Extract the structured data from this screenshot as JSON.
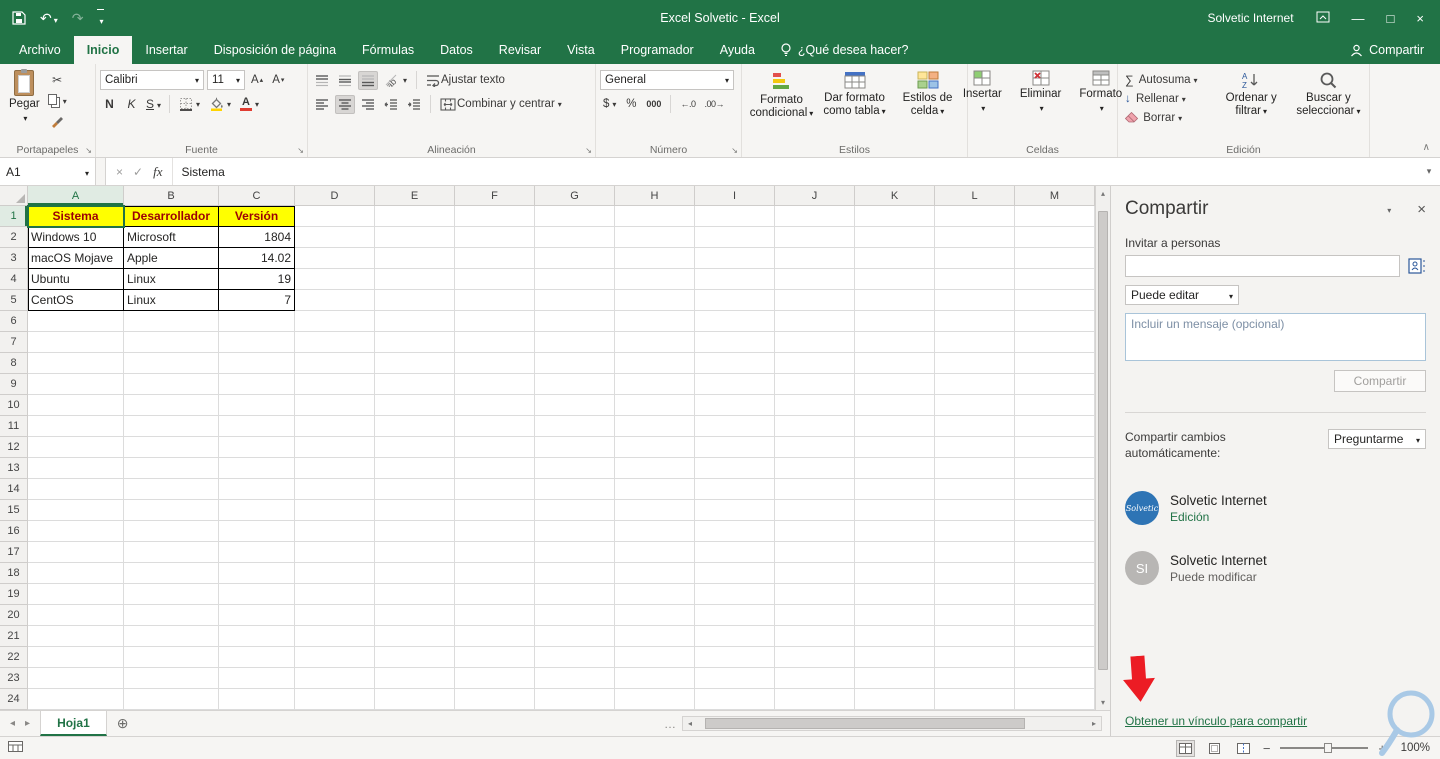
{
  "titlebar": {
    "title": "Excel Solvetic  -  Excel",
    "account": "Solvetic Internet"
  },
  "ribbon": {
    "tabs": [
      {
        "id": "archivo",
        "label": "Archivo",
        "active": false
      },
      {
        "id": "inicio",
        "label": "Inicio",
        "active": true
      },
      {
        "id": "insertar",
        "label": "Insertar",
        "active": false
      },
      {
        "id": "disposicion-de-pagina",
        "label": "Disposición de página",
        "active": false
      },
      {
        "id": "formulas",
        "label": "Fórmulas",
        "active": false
      },
      {
        "id": "datos",
        "label": "Datos",
        "active": false
      },
      {
        "id": "revisar",
        "label": "Revisar",
        "active": false
      },
      {
        "id": "vista",
        "label": "Vista",
        "active": false
      },
      {
        "id": "programador",
        "label": "Programador",
        "active": false
      },
      {
        "id": "ayuda",
        "label": "Ayuda",
        "active": false
      }
    ],
    "tell_me": "¿Qué desea hacer?",
    "share": "Compartir",
    "clipboard": {
      "title": "Portapapeles",
      "paste": "Pegar"
    },
    "font": {
      "title": "Fuente",
      "name": "Calibri",
      "size": "11",
      "bold": "N",
      "italic": "K",
      "underline": "S"
    },
    "alignment": {
      "title": "Alineación",
      "wrap": "Ajustar texto",
      "merge": "Combinar y centrar"
    },
    "number": {
      "title": "Número",
      "format": "General",
      "currency": "$",
      "percent": "%",
      "thousands": "000"
    },
    "styles": {
      "title": "Estilos",
      "conditional": "Formato condicional",
      "as_table": "Dar formato como tabla",
      "cell_styles": "Estilos de celda"
    },
    "cells": {
      "title": "Celdas",
      "insert": "Insertar",
      "delete": "Eliminar",
      "format": "Formato"
    },
    "editing": {
      "title": "Edición",
      "autosum": "Autosuma",
      "fill": "Rellenar",
      "clear": "Borrar",
      "sort": "Ordenar y filtrar",
      "find": "Buscar y seleccionar"
    }
  },
  "formula_bar": {
    "name_box": "A1",
    "content": "Sistema"
  },
  "grid": {
    "columns": [
      "A",
      "B",
      "C",
      "D",
      "E",
      "F",
      "G",
      "H",
      "I",
      "J",
      "K",
      "L",
      "M"
    ],
    "row_count": 24,
    "selected_cell": "A1"
  },
  "table": {
    "header_row": [
      "Sistema",
      "Desarrollador",
      "Versión"
    ],
    "data_rows": [
      [
        "Windows 10",
        "Microsoft",
        "1804"
      ],
      [
        "macOS Mojave",
        "Apple",
        "14.02"
      ],
      [
        "Ubuntu",
        "Linux",
        "19"
      ],
      [
        "CentOS",
        "Linux",
        "7"
      ]
    ],
    "header_fill": "#ffff00",
    "header_text_color": "#9c0006"
  },
  "sheet_bar": {
    "tabs": [
      {
        "label": "Hoja1",
        "active": true
      }
    ]
  },
  "share_pane": {
    "title": "Compartir",
    "invite_label": "Invitar a personas",
    "permission": "Puede editar",
    "message_placeholder": "Incluir un mensaje (opcional)",
    "share_button": "Compartir",
    "auto_share_label": "Compartir cambios automáticamente:",
    "auto_share_value": "Preguntarme",
    "users": [
      {
        "name": "Solvetic Internet",
        "role": "Edición",
        "role_color": "#217346",
        "avatar_text": "Solvetic",
        "avatar_color": "#2e74b5",
        "avatar_style": "script"
      },
      {
        "name": "Solvetic Internet",
        "role": "Puede modificar",
        "role_color": "#605e5c",
        "avatar_text": "SI",
        "avatar_color": "#b8b6b4",
        "avatar_style": "initials"
      }
    ],
    "get_link": "Obtener un vínculo para compartir"
  },
  "status_bar": {
    "zoom": "100%"
  },
  "icons": {
    "scissors": "✂",
    "autosum": "∑",
    "undo": "↶",
    "redo": "↷",
    "add_sheet": "⊕",
    "close": "×",
    "cancel": "×",
    "enter": "✓",
    "fx": "fx",
    "ellipsis": "…",
    "zoom_out": "−",
    "zoom_in": "+",
    "fill_down": "↓",
    "minimize": "—",
    "maximize": "□",
    "scroll_up": "▴",
    "scroll_down": "▾",
    "scroll_left": "◂",
    "scroll_right": "▸",
    "launcher": "↘",
    "collapse_ribbon": "∧",
    "increase_decimal": "←.0",
    "decrease_decimal": ".00→"
  },
  "colors": {
    "excel_green": "#217346",
    "annotation_red": "#ec1c24",
    "annotation_blue": "#a9c9e6"
  }
}
